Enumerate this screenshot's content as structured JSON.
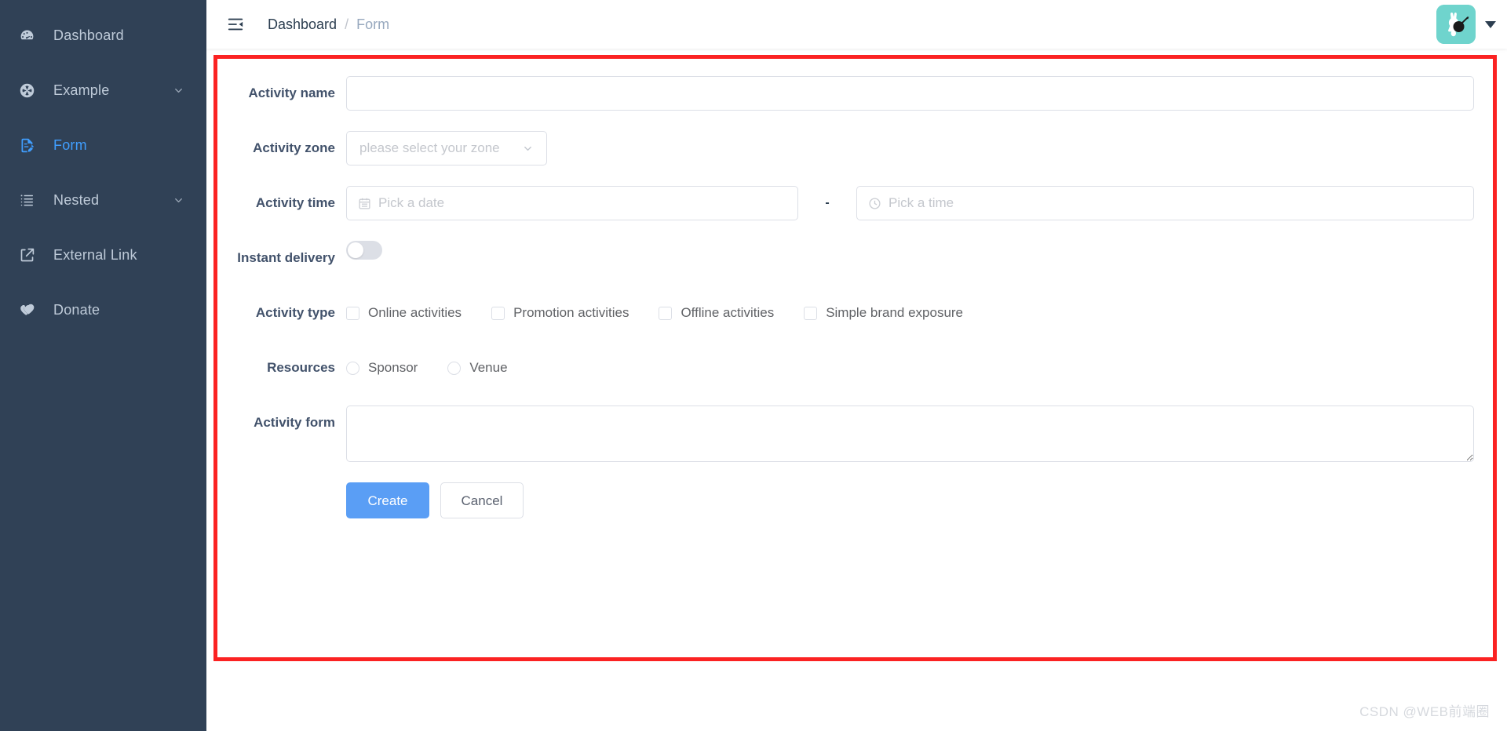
{
  "sidebar": {
    "items": [
      {
        "label": "Dashboard",
        "icon": "dashboard-gauge-icon",
        "active": false,
        "expandable": false
      },
      {
        "label": "Example",
        "icon": "example-compass-icon",
        "active": false,
        "expandable": true
      },
      {
        "label": "Form",
        "icon": "form-document-icon",
        "active": true,
        "expandable": false
      },
      {
        "label": "Nested",
        "icon": "nested-list-icon",
        "active": false,
        "expandable": true
      },
      {
        "label": "External Link",
        "icon": "external-link-icon",
        "active": false,
        "expandable": false
      },
      {
        "label": "Donate",
        "icon": "donate-heart-icon",
        "active": false,
        "expandable": false
      }
    ],
    "background_color": "#304156",
    "active_color": "#409eff",
    "text_color": "#bfcbd9"
  },
  "navbar": {
    "hamburger_icon": "collapse-menu-icon",
    "breadcrumb": {
      "root": "Dashboard",
      "separator": "/",
      "current": "Form"
    },
    "avatar": {
      "icon": "user-avatar",
      "background_color": "#6fd4cd"
    },
    "caret_icon": "chevron-down-icon"
  },
  "form": {
    "highlight_border_color": "#fb2222",
    "rows": {
      "activity_name": {
        "label": "Activity name",
        "value": "",
        "placeholder": ""
      },
      "activity_zone": {
        "label": "Activity zone",
        "selected": "please select your zone",
        "caret_icon": "chevron-down-icon"
      },
      "activity_time": {
        "label": "Activity time",
        "date_placeholder": "Pick a date",
        "date_value": "",
        "date_icon": "calendar-icon",
        "separator": "-",
        "time_placeholder": "Pick a time",
        "time_value": "",
        "time_icon": "clock-icon"
      },
      "instant_delivery": {
        "label": "Instant delivery",
        "checked": false
      },
      "activity_type": {
        "label": "Activity type",
        "options": [
          {
            "label": "Online activities",
            "checked": false
          },
          {
            "label": "Promotion activities",
            "checked": false
          },
          {
            "label": "Offline activities",
            "checked": false
          },
          {
            "label": "Simple brand exposure",
            "checked": false
          }
        ]
      },
      "resources": {
        "label": "Resources",
        "options": [
          {
            "label": "Sponsor",
            "checked": false
          },
          {
            "label": "Venue",
            "checked": false
          }
        ]
      },
      "activity_form": {
        "label": "Activity form",
        "value": "",
        "placeholder": ""
      }
    },
    "actions": {
      "submit_label": "Create",
      "cancel_label": "Cancel",
      "submit_color": "#5a9ef5"
    }
  },
  "watermark": "CSDN @WEB前端圈"
}
